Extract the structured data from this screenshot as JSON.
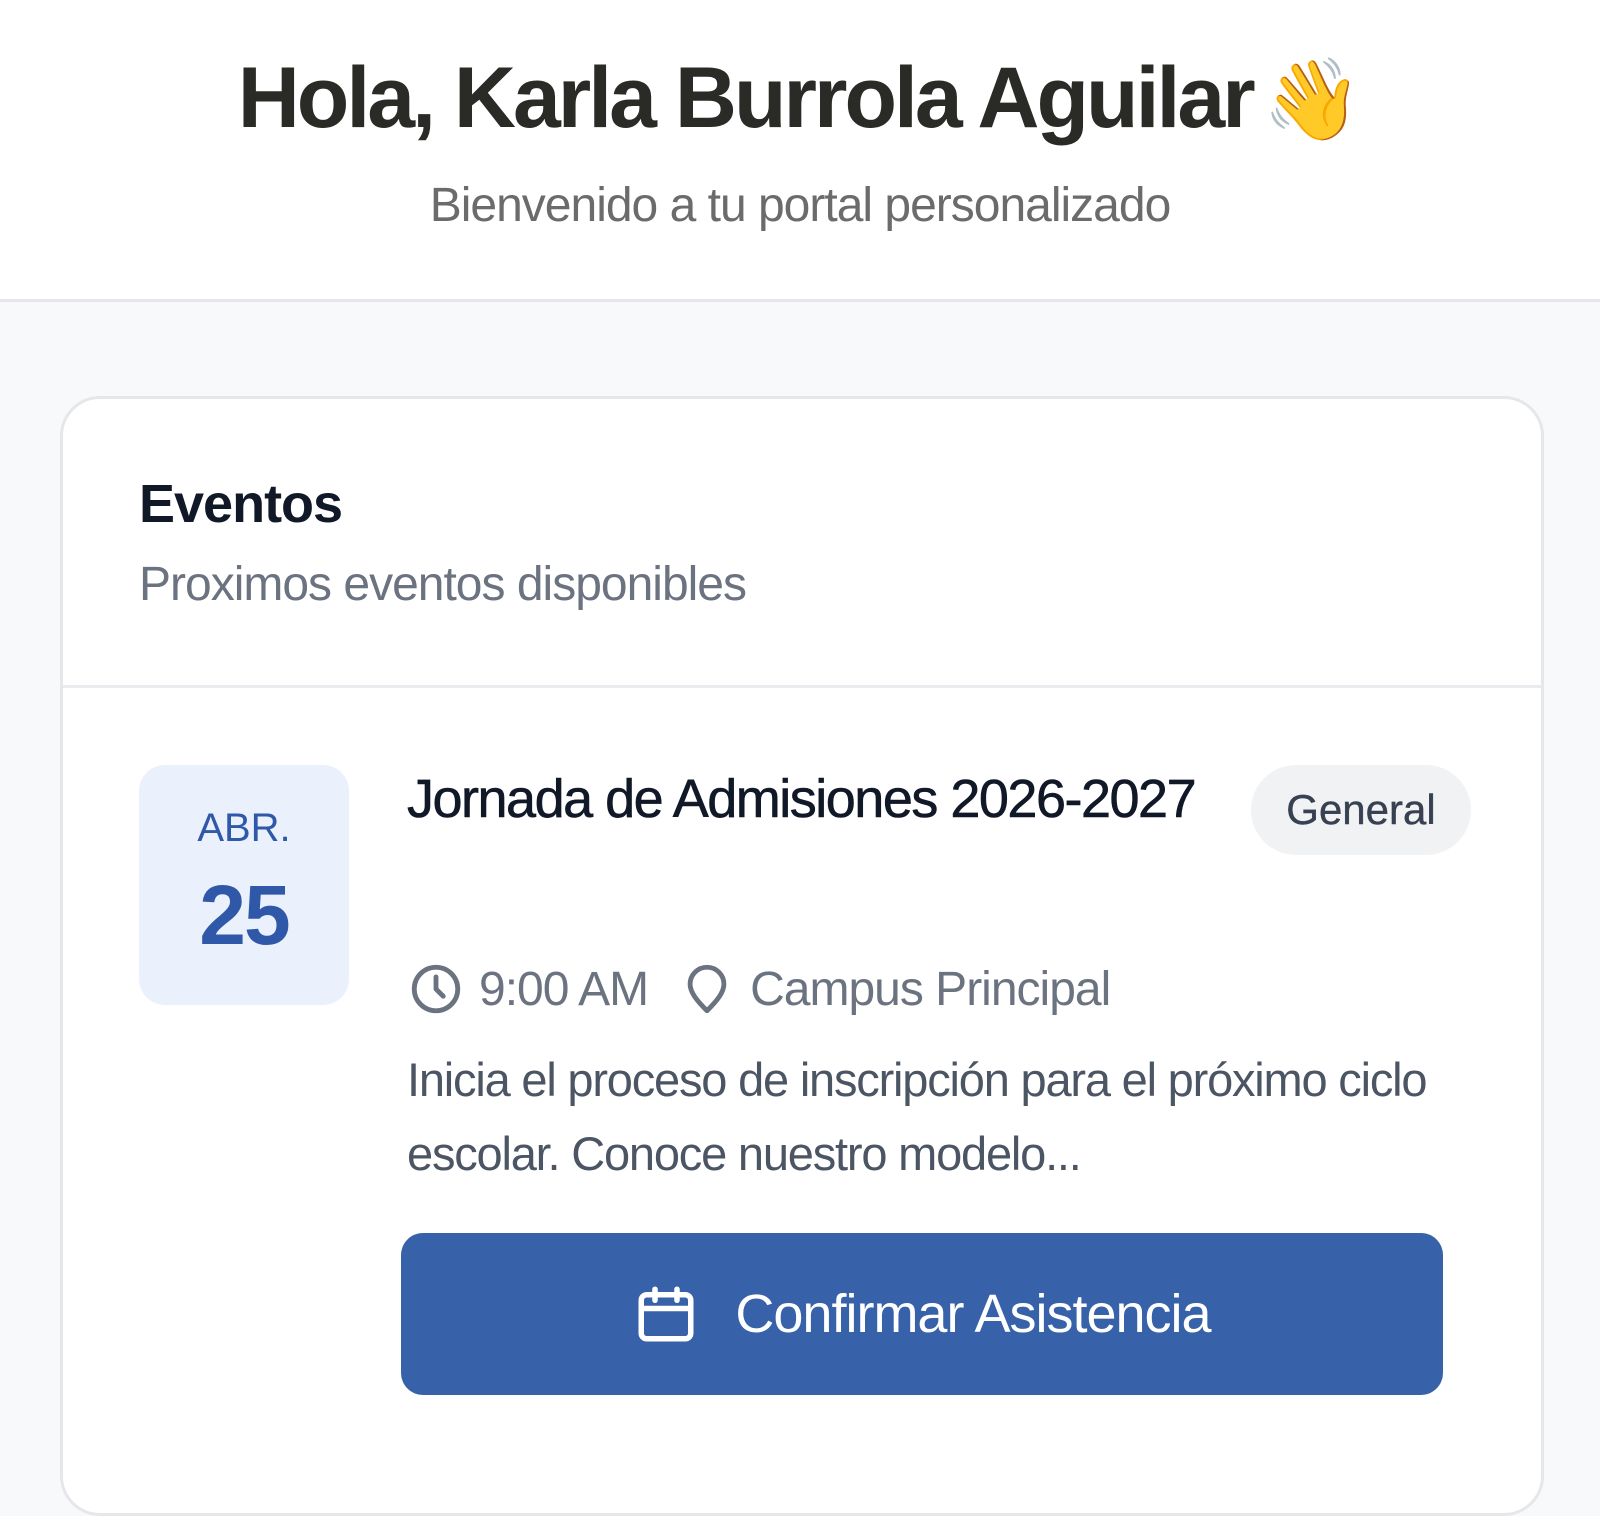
{
  "header": {
    "greeting": "Hola, Karla Burrola Aguilar",
    "greeting_emoji": "👋",
    "subtitle": "Bienvenido a tu portal personalizado"
  },
  "events_card": {
    "title": "Eventos",
    "subtitle": "Proximos eventos disponibles",
    "events": [
      {
        "month": "ABR.",
        "day": "25",
        "title": "Jornada de Admisiones 2026-2027",
        "category": "General",
        "time": "9:00 AM",
        "location": "Campus Principal",
        "description": "Inicia el proceso de inscripción para el próximo ciclo escolar. Conoce nuestro modelo...",
        "action_label": "Confirmar Asistencia"
      }
    ]
  },
  "icons": {
    "time": "clock-icon",
    "location": "map-pin-icon",
    "action": "calendar-icon"
  },
  "colors": {
    "accent": "#3761a9",
    "date_bg": "#eaf1fc",
    "date_text": "#2f59a8",
    "page_bg": "#f8f9fb"
  }
}
